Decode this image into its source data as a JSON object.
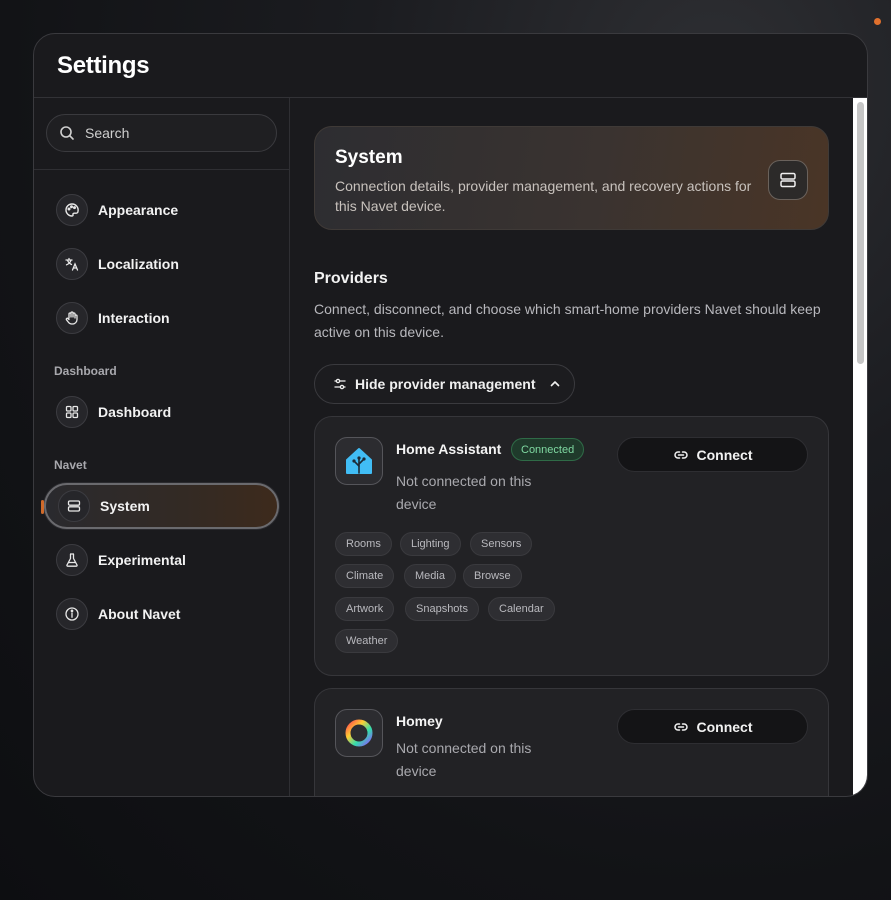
{
  "window": {
    "title": "Settings"
  },
  "sidebar": {
    "search_placeholder": "Search",
    "items": [
      {
        "label": "Appearance",
        "icon": "palette-icon"
      },
      {
        "label": "Localization",
        "icon": "translate-icon"
      },
      {
        "label": "Interaction",
        "icon": "hand-icon"
      }
    ],
    "sections": [
      {
        "label": "Dashboard",
        "items": [
          {
            "label": "Dashboard",
            "icon": "grid-icon"
          }
        ]
      },
      {
        "label": "Navet",
        "items": [
          {
            "label": "System",
            "icon": "server-icon",
            "active": true
          },
          {
            "label": "Experimental",
            "icon": "flask-icon"
          },
          {
            "label": "About Navet",
            "icon": "info-icon"
          }
        ]
      }
    ]
  },
  "main": {
    "hero": {
      "title": "System",
      "description": "Connection details, provider management, and recovery actions for this Navet device."
    },
    "providers": {
      "title": "Providers",
      "description": "Connect, disconnect, and choose which smart-home providers Navet should keep active on this device.",
      "toggle_label": "Hide provider management",
      "list": [
        {
          "name": "Home Assistant",
          "badge": "Connected",
          "status": "Not connected on this device",
          "button": "Connect",
          "chips": [
            "Rooms",
            "Lighting",
            "Sensors",
            "Climate",
            "Media",
            "Browse",
            "Artwork",
            "Snapshots",
            "Calendar",
            "Weather"
          ]
        },
        {
          "name": "Homey",
          "status": "Not connected on this device",
          "button": "Connect"
        }
      ]
    }
  },
  "colors": {
    "accent": "#d06a2a",
    "badge_green": "#7fd8a1",
    "home_assistant_blue": "#41bdf5"
  }
}
